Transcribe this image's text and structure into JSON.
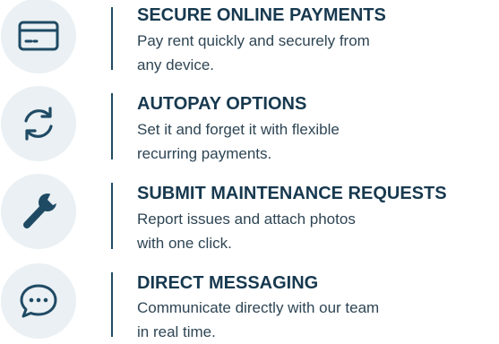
{
  "colors": {
    "icon_background": "#eaf0f3",
    "icon_stroke": "#1f4a64",
    "title_text": "#17394f",
    "body_text": "#2e4554",
    "divider": "#1f4a64"
  },
  "features": [
    {
      "icon": "credit-card-icon",
      "title": "SECURE ONLINE PAYMENTS",
      "description_lines": [
        "Pay rent quickly and securely from",
        "any device."
      ]
    },
    {
      "icon": "refresh-cycle-icon",
      "title": "AUTOPAY OPTIONS",
      "description_lines": [
        "Set it and forget it with flexible",
        "recurring payments."
      ]
    },
    {
      "icon": "wrench-icon",
      "title": "SUBMIT MAINTENANCE REQUESTS",
      "description_lines": [
        "Report issues and attach photos",
        "with one click."
      ]
    },
    {
      "icon": "chat-bubble-icon",
      "title": "DIRECT MESSAGING",
      "description_lines": [
        "Communicate directly with our team",
        "in real time."
      ]
    }
  ]
}
